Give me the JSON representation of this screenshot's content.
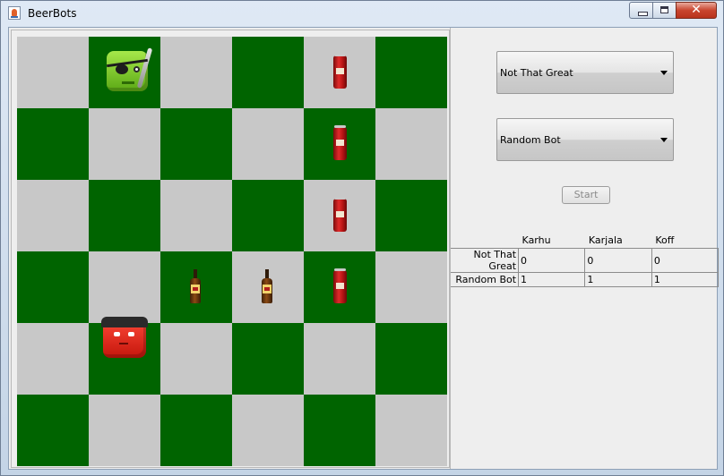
{
  "window": {
    "title": "BeerBots",
    "close_glyph": "✕"
  },
  "controls": {
    "bot1_selected": "Not That Great",
    "bot2_selected": "Random Bot",
    "start_label": "Start"
  },
  "scoreboard": {
    "columns": [
      "Karhu",
      "Karjala",
      "Koff"
    ],
    "rows": [
      {
        "bot": "Not That Great",
        "scores": [
          "0",
          "0",
          "0"
        ]
      },
      {
        "bot": "Random Bot",
        "scores": [
          "1",
          "1",
          "1"
        ]
      }
    ]
  },
  "board": {
    "size": 6,
    "colors": {
      "light": "#c8c8c8",
      "dark": "#006400"
    },
    "pieces": [
      {
        "row": 0,
        "col": 1,
        "type": "bot-green-pirate"
      },
      {
        "row": 0,
        "col": 4,
        "type": "can-karjala"
      },
      {
        "row": 1,
        "col": 4,
        "type": "can-karjala"
      },
      {
        "row": 2,
        "col": 4,
        "type": "can-karjala"
      },
      {
        "row": 3,
        "col": 2,
        "type": "bottle-koff"
      },
      {
        "row": 3,
        "col": 3,
        "type": "bottle-koff"
      },
      {
        "row": 3,
        "col": 4,
        "type": "can-karjala"
      },
      {
        "row": 4,
        "col": 1,
        "type": "bot-red-ninja"
      }
    ]
  }
}
